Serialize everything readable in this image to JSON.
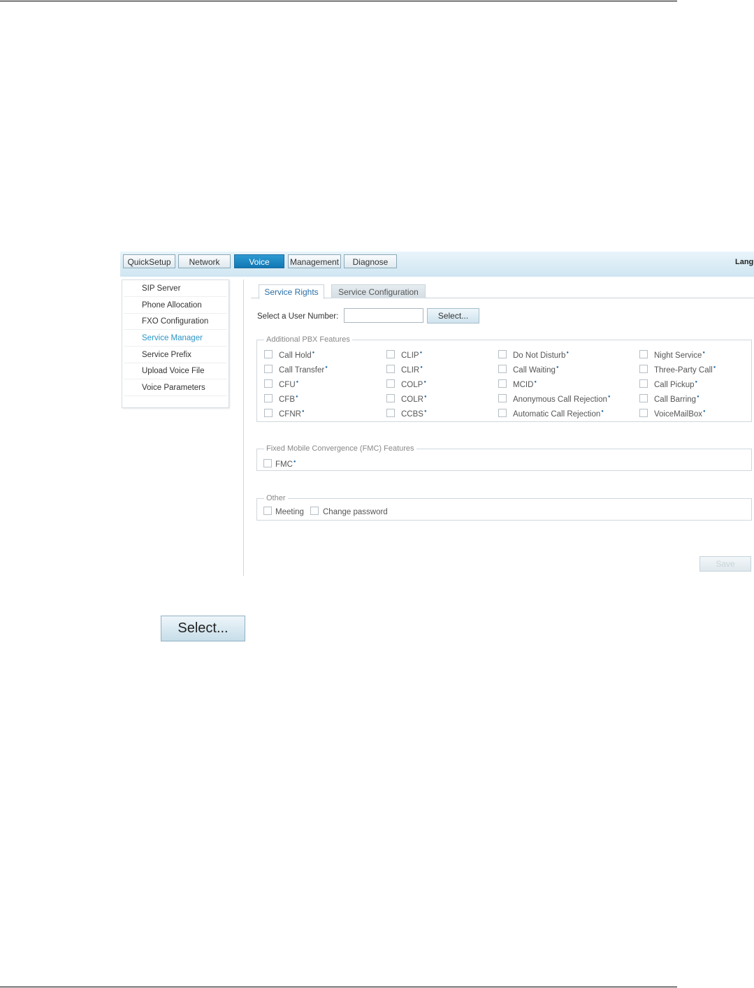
{
  "nav": {
    "items": [
      "QuickSetup",
      "Network",
      "Voice",
      "Management",
      "Diagnose"
    ],
    "active": "Voice",
    "language_label": "Langu"
  },
  "sidebar": {
    "items": [
      "SIP Server",
      "Phone Allocation",
      "FXO Configuration",
      "Service Manager",
      "Service Prefix",
      "Upload Voice File",
      "Voice Parameters"
    ],
    "active": "Service Manager"
  },
  "tabs": {
    "service_rights": "Service Rights",
    "service_configuration": "Service Configuration"
  },
  "user_select": {
    "label": "Select a User Number:",
    "value": "",
    "button": "Select..."
  },
  "pbx": {
    "legend": "Additional PBX Features",
    "columns": [
      [
        "Call Hold",
        "Call Transfer",
        "CFU",
        "CFB",
        "CFNR"
      ],
      [
        "CLIP",
        "CLIR",
        "COLP",
        "COLR",
        "CCBS"
      ],
      [
        "Do Not Disturb",
        "Call Waiting",
        "MCID",
        "Anonymous Call Rejection",
        "Automatic Call Rejection"
      ],
      [
        "Night Service",
        "Three-Party Call",
        "Call Pickup",
        "Call Barring",
        "VoiceMailBox"
      ]
    ]
  },
  "fmc": {
    "legend": "Fixed Mobile Convergence (FMC) Features",
    "items": [
      "FMC"
    ]
  },
  "other": {
    "legend": "Other",
    "items": [
      "Meeting",
      "Change password"
    ]
  },
  "save_button": "Save",
  "illustration": {
    "select_button": "Select..."
  },
  "colors": {
    "active_nav": "#1a85c4",
    "active_sidebar_text": "#2a95c5",
    "topbar": "#d6eaf5"
  }
}
